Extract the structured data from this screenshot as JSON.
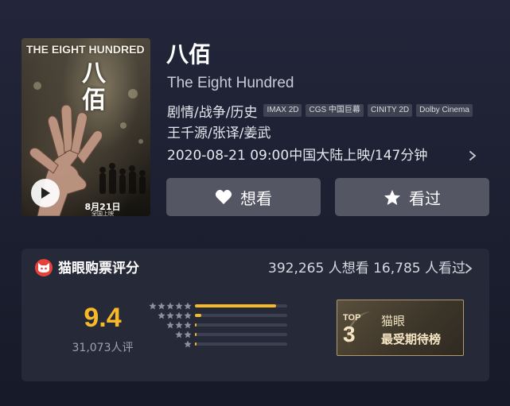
{
  "movie": {
    "title_cn": "八佰",
    "title_en": "The Eight Hundred",
    "genres": "剧情/战争/历史",
    "format_tags": [
      "IMAX 2D",
      "CGS 中国巨幕",
      "CINITY 2D",
      "Dolby Cinema"
    ],
    "cast": "王千源/张译/姜武",
    "release": "2020-08-21 09:00中国大陆上映/147分钟"
  },
  "poster": {
    "title_en": "THE EIGHT HUNDRED",
    "title_cn": "八佰",
    "date": "8月21日",
    "date_sub": "全国上映"
  },
  "actions": {
    "want_label": "想看",
    "seen_label": "看过"
  },
  "rating": {
    "label": "猫眼购票评分",
    "audience_stats": "392,265 人想看  16,785 人看过",
    "score": "9.4",
    "count": "31,073人评",
    "distribution": [
      {
        "stars": 5,
        "fraction": 0.88
      },
      {
        "stars": 4,
        "fraction": 0.07
      },
      {
        "stars": 3,
        "fraction": 0.02
      },
      {
        "stars": 2,
        "fraction": 0.01
      },
      {
        "stars": 1,
        "fraction": 0.02
      }
    ],
    "rank": {
      "top_label": "TOP",
      "top_number": "3",
      "brand": "猫眼",
      "list_name": "最受期待榜"
    }
  },
  "colors": {
    "accent": "#f8b929",
    "brand": "#e8413c",
    "button": "#545663"
  }
}
